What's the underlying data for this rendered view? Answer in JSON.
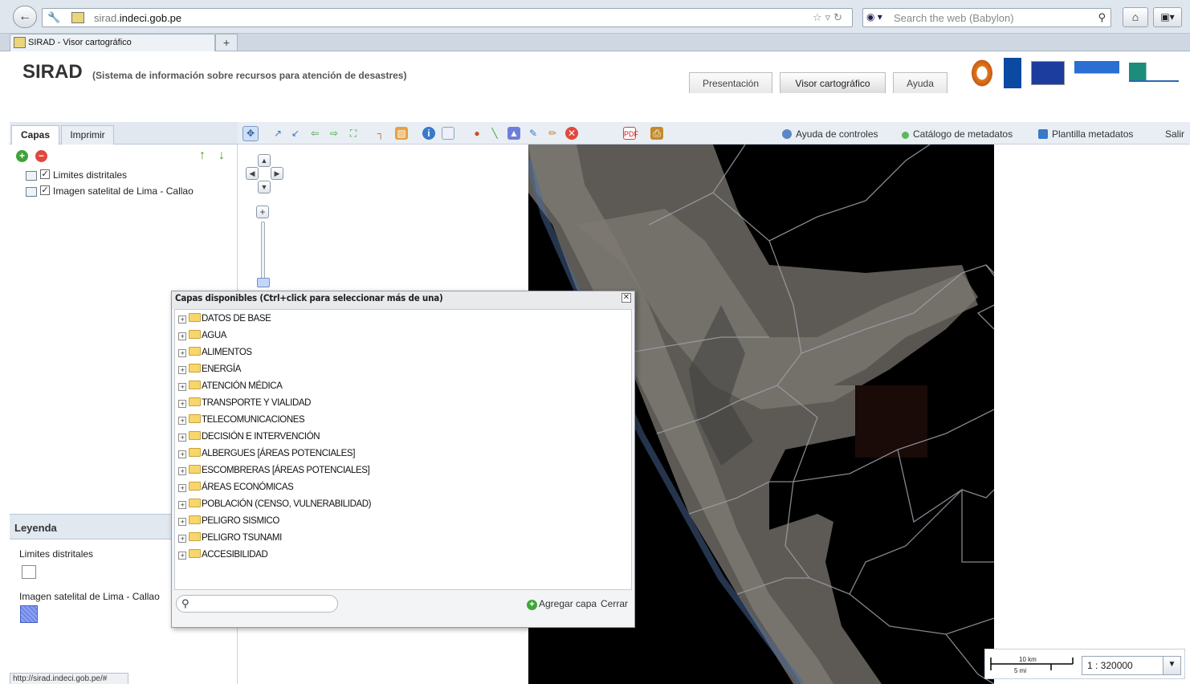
{
  "browser": {
    "url_host_prefix": "sirad.",
    "url_host_main": "indeci.gob.pe",
    "search_placeholder": "Search the web (Babylon)",
    "tab_title": "SIRAD - Visor cartográfico",
    "new_tab_label": "+",
    "status_url": "http://sirad.indeci.gob.pe/#"
  },
  "header": {
    "title": "SIRAD",
    "subtitle": "(Sistema de información sobre recursos para atención de desastres)",
    "nav": [
      {
        "label": "Presentación"
      },
      {
        "label": "Visor cartográfico"
      },
      {
        "label": "Ayuda"
      }
    ]
  },
  "left_panel": {
    "tabs": [
      {
        "label": "Capas"
      },
      {
        "label": "Imprimir"
      }
    ],
    "layers": [
      {
        "label": "Limites distritales",
        "checked": true
      },
      {
        "label": "Imagen satelital de Lima - Callao",
        "checked": true
      }
    ],
    "legend": {
      "title": "Leyenda",
      "items": [
        {
          "label": "Limites distritales"
        },
        {
          "label": "Imagen satelital de Lima - Callao"
        }
      ]
    }
  },
  "map_toolbar": {
    "links": [
      {
        "label": "Ayuda de controles",
        "icon": "help-icon"
      },
      {
        "label": "Catálogo de metadatos",
        "icon": "catalog-icon"
      },
      {
        "label": "Plantilla metadatos",
        "icon": "template-icon"
      },
      {
        "label": "Salir",
        "icon": ""
      }
    ]
  },
  "scale": {
    "km_label": "10 km",
    "mi_label": "5 mi",
    "value": "1 : 320000"
  },
  "dialog": {
    "title": "Capas disponibles (Ctrl+click para seleccionar más de una)",
    "categories": [
      "DATOS DE BASE",
      "AGUA",
      "ALIMENTOS",
      "ENERGÍA",
      "ATENCIÓN MÉDICA",
      "TRANSPORTE Y VIALIDAD",
      "TELECOMUNICACIONES",
      "DECISIÓN E INTERVENCIÓN",
      "ALBERGUES [ÁREAS POTENCIALES]",
      "ESCOMBRERAS [ÁREAS POTENCIALES]",
      "ÁREAS ECONÓMICAS",
      "POBLACIÓN (CENSO, VULNERABILIDAD)",
      "PELIGRO SISMICO",
      "PELIGRO TSUNAMI",
      "ACCESIBILIDAD"
    ],
    "search_value": "",
    "add_label": "Agregar capa",
    "close_label": "Cerrar"
  }
}
